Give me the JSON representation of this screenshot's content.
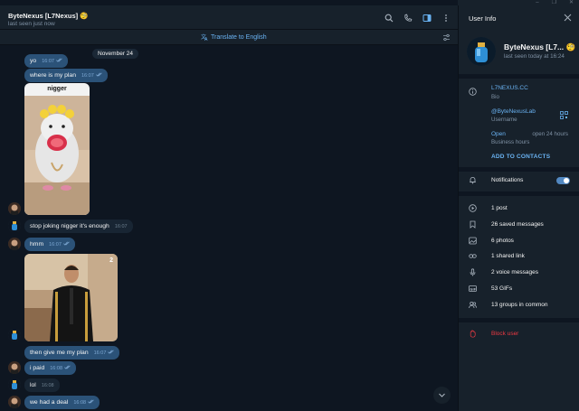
{
  "window": {
    "controls": [
      "–",
      "❐",
      "✕"
    ]
  },
  "header": {
    "peer_name": "ByteNexus [L7Nexus] 🧐",
    "status": "last seen just now",
    "icons": [
      "search-icon",
      "phone-icon",
      "sidebar-toggle-icon",
      "more-icon"
    ]
  },
  "translate": {
    "label": "Translate to English",
    "icon": "translate-icon"
  },
  "date_pill": "November 24",
  "messages": [
    {
      "dir": "out",
      "text": "yo",
      "time": "16:07",
      "read": true
    },
    {
      "dir": "out",
      "text": "where is my plan",
      "time": "16:07",
      "read": true
    },
    {
      "dir": "out",
      "type": "photo",
      "caption": "nigger"
    },
    {
      "dir": "in",
      "text": "stop joking nigger it's enough",
      "time": "16:07"
    },
    {
      "dir": "out",
      "text": "hmm",
      "time": "16:07",
      "read": true
    },
    {
      "dir": "out",
      "type": "photo",
      "badge": "2"
    },
    {
      "dir": "out",
      "text": "then give me my plan",
      "time": "16:07",
      "read": true
    },
    {
      "dir": "out",
      "text": "i paid",
      "time": "16:08",
      "read": true
    },
    {
      "dir": "in",
      "text": "lol",
      "time": "16:08"
    },
    {
      "dir": "out",
      "text": "we had a deal",
      "time": "16:08",
      "read": true
    }
  ],
  "panel": {
    "title": "User Info",
    "name": "ByteNexus [L7...",
    "name_emoji": "🧐",
    "last_seen": "last seen today at 16:24",
    "bio_value": "L7NEXUS.CC",
    "bio_label": "Bio",
    "username_value": "@ByteNexusLab",
    "username_label": "Username",
    "hours_value": "Open",
    "hours_right": "open 24 hours",
    "hours_label": "Business hours",
    "add_contacts": "ADD TO CONTACTS",
    "notifications": "Notifications",
    "notifications_on": true,
    "media": [
      {
        "icon": "post-icon",
        "label": "1 post"
      },
      {
        "icon": "bookmark-icon",
        "label": "26 saved messages"
      },
      {
        "icon": "photo-icon",
        "label": "6 photos"
      },
      {
        "icon": "link-icon",
        "label": "1 shared link"
      },
      {
        "icon": "mic-icon",
        "label": "2 voice messages"
      },
      {
        "icon": "gif-icon",
        "label": "53 GIFs"
      },
      {
        "icon": "groups-icon",
        "label": "13 groups in common"
      }
    ],
    "block": "Block user"
  },
  "colors": {
    "bg": "#0e1621",
    "panel": "#17212b",
    "bubble_out": "#2b5278",
    "bubble_in": "#182533",
    "accent": "#6ab3f3",
    "danger": "#ec3942"
  }
}
